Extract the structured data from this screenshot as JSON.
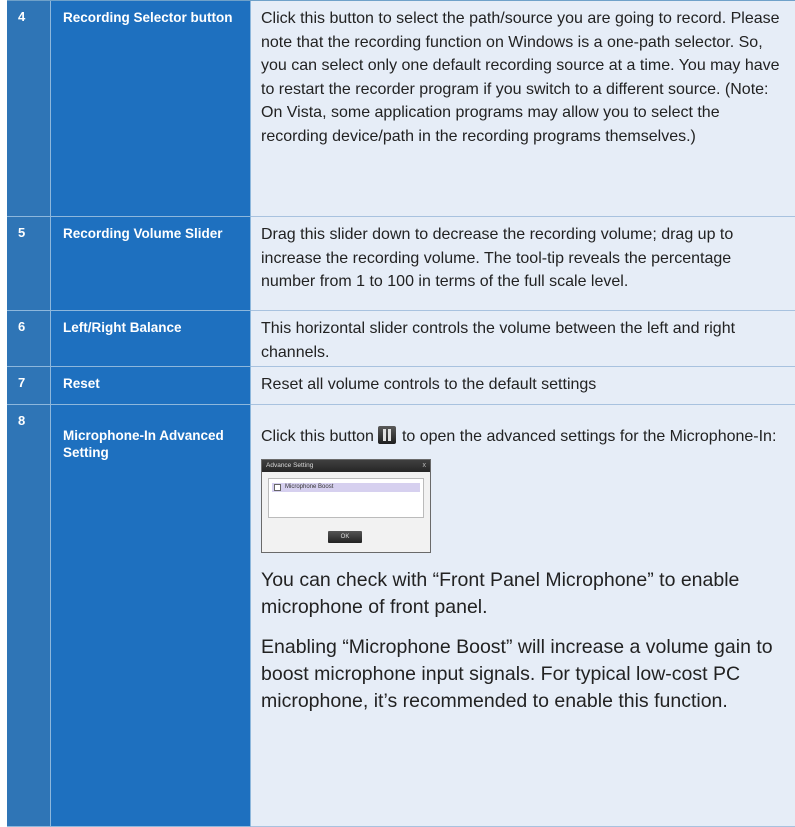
{
  "rows": [
    {
      "num": "4",
      "name": "Recording Selector button",
      "desc": "Click this button to select the path/source you are going to record. Please note that the recording function on Windows is a one-path selector. So, you can select only one default recording source at a time. You may have to restart the recorder program if you switch to a different source. (Note: On Vista, some application programs may allow you to select the recording device/path in the recording programs themselves.)"
    },
    {
      "num": "5",
      "name": "Recording Volume Slider",
      "desc": "Drag this slider down to decrease the recording volume; drag up to increase the recording volume. The tool-tip reveals the percentage number from 1 to 100 in terms of the full scale level."
    },
    {
      "num": "6",
      "name": "Left/Right Balance",
      "desc": "This horizontal slider controls the volume between the left and right channels."
    },
    {
      "num": "7",
      "name": "Reset",
      "desc": "Reset all volume controls to the default settings"
    },
    {
      "num": "8",
      "name": "Microphone-In Advanced Setting",
      "desc_before_icon": "Click this button",
      "desc_after_icon": "to open the advanced settings for the Microphone-In:",
      "icon": "advanced-settings-icon",
      "dialog": {
        "title": "Advance Setting",
        "close": "x",
        "checkbox_label": "Microphone Boost",
        "ok": "OK"
      },
      "para1": "You can check with “Front Panel Microphone” to enable microphone of front panel.",
      "para2": "Enabling “Microphone Boost” will increase a volume gain to boost microphone input signals. For typical low-cost PC microphone, it’s recommended to  enable this function."
    }
  ]
}
